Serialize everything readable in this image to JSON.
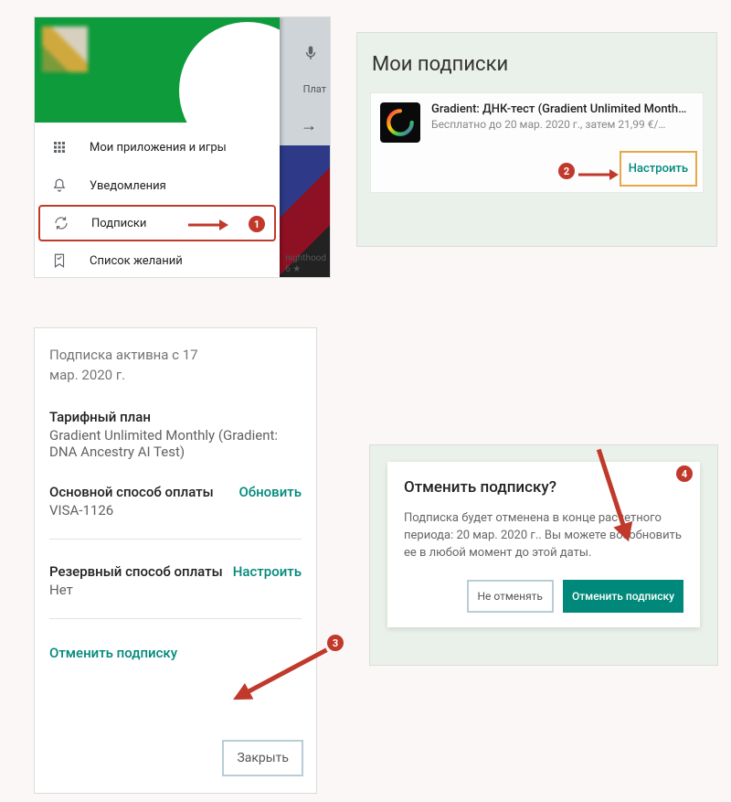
{
  "markers": {
    "b1": "1",
    "b2": "2",
    "b3": "3",
    "b4": "4"
  },
  "panel1": {
    "bg": {
      "chip": "Плат",
      "arrow": "→",
      "caption1": "nighthood",
      "caption2": "6 ★"
    },
    "menu": {
      "apps": "Мои приложения и игры",
      "notifications": "Уведомления",
      "subscriptions": "Подписки",
      "wishlist": "Список желаний"
    }
  },
  "panel2": {
    "title": "Мои подписки",
    "app": {
      "name": "Gradient: ДНК-тест (Gradient Unlimited Month…",
      "sub": "Бесплатно до 20 мар. 2020 г., затем 21,99 €/…"
    },
    "link": "Настроить"
  },
  "panel3": {
    "active_line1": "Подписка активна с 17",
    "active_line2": "мар. 2020 г.",
    "plan_h": "Тарифный план",
    "plan_v": "Gradient Unlimited Monthly (Gradient: DNA Ancestry AI Test)",
    "pay_h": "Основной способ оплаты",
    "pay_v": "VISA-1126",
    "pay_link": "Обновить",
    "backup_h": "Резервный способ оплаты",
    "backup_v": "Нет",
    "backup_link": "Настроить",
    "cancel": "Отменить подписку",
    "close": "Закрыть"
  },
  "panel4": {
    "title": "Отменить подписку?",
    "body": "Подписка будет отменена в конце расчетного периода: 20 мар. 2020 г.. Вы можете возобновить ее в любой момент до этой даты.",
    "no": "Не отменять",
    "yes": "Отменить подписку"
  }
}
